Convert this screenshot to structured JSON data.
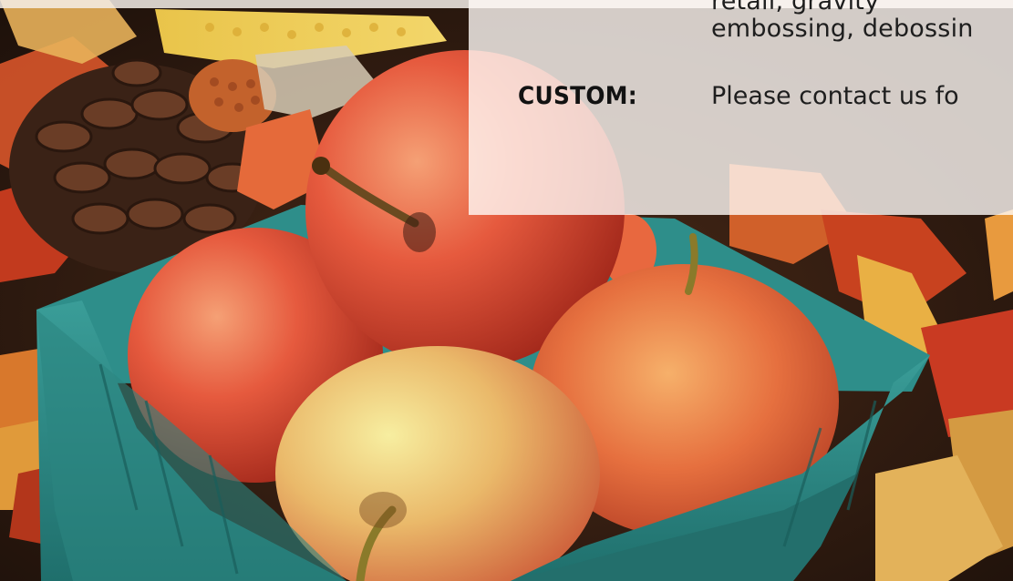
{
  "panel": {
    "clipped_line_top": "retail, gravity",
    "embossing_line": "embossing, debossin",
    "custom_label": "CUSTOM:",
    "custom_text": "Please contact us fo"
  },
  "image": {
    "description_icon": "apple-basket-photo"
  },
  "colors": {
    "basket_teal": "#2e8e8a",
    "apple_red": "#e0523a",
    "panel_bg": "#fffaf6"
  }
}
